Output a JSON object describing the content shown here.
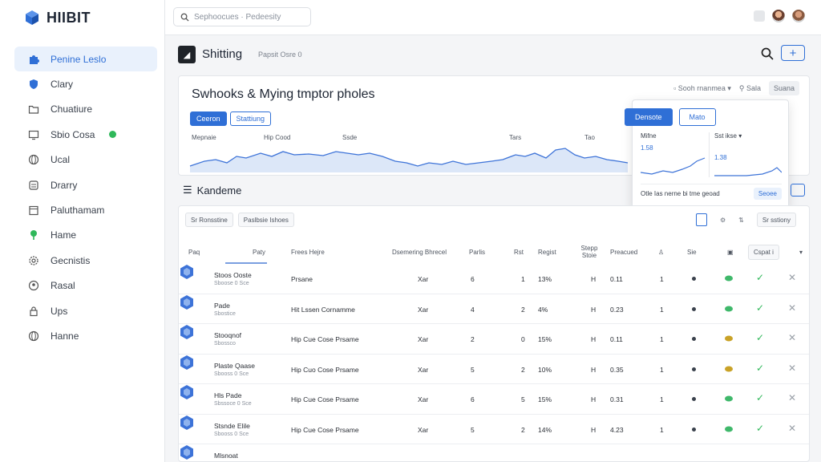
{
  "app": {
    "logo_text": "HIIBIT"
  },
  "search": {
    "placeholder": "Sephoocues · Pedeesity"
  },
  "sidebar": {
    "items": [
      {
        "label": "Penine Leslo",
        "icon": "puzzle-icon",
        "active": true
      },
      {
        "label": "Clary",
        "icon": "shield-icon"
      },
      {
        "label": "Chuatiure",
        "icon": "folder-icon"
      },
      {
        "label": "Sbio Cosa",
        "icon": "monitor-icon",
        "badge": "online"
      },
      {
        "label": "Ucal",
        "icon": "globe-icon"
      },
      {
        "label": "Drarry",
        "icon": "layers-icon"
      },
      {
        "label": "Paluthamam",
        "icon": "calendar-icon"
      },
      {
        "label": "Hame",
        "icon": "tree-icon"
      },
      {
        "label": "Gecnistis",
        "icon": "gear-icon"
      },
      {
        "label": "Rasal",
        "icon": "pin-icon"
      },
      {
        "label": "Ups",
        "icon": "lock-icon"
      },
      {
        "label": "Hanne",
        "icon": "globe-icon"
      }
    ]
  },
  "header": {
    "title": "Shitting",
    "subtitle": "Papsit Osre 0",
    "add_label": "+"
  },
  "card": {
    "title": "Swhooks & Mying tmptor pholes",
    "tool1": "Sooh rnanmea",
    "tool2": "Sala",
    "tool3": "Suana",
    "seg_on": "Ceeron",
    "seg_off": "Stattiung",
    "axis": [
      "Mepnaie",
      "Hip Cood",
      "Ssde",
      "Tars",
      "Tao"
    ]
  },
  "popover": {
    "btn_on": "Densote",
    "btn_off": "Mato",
    "left_label": "Mifne",
    "left_value": "1.58",
    "right_label": "Sst ikse",
    "right_value": "1.38",
    "footer_text": "Otle Ias nerne bi tme geoad",
    "footer_btn": "Seoee"
  },
  "section": {
    "title": "Kandeme"
  },
  "table": {
    "chips": [
      "Sr Ronsstine",
      "Paslbsie Ishoes"
    ],
    "toolbar_right": "Sr sstiony",
    "tab_label": "Paty",
    "headers": [
      "Paq",
      "Frees Hejre",
      "Dsemering Bhrecel",
      "Parlis",
      "Rst",
      "Regist",
      "Stepp Stoie",
      "Preacued",
      "Sie",
      "Cspat i"
    ],
    "rows": [
      {
        "name": "Stoos Ooste",
        "sub": "Sboose 0 Sce",
        "type": "Prsane",
        "rst": "Xar",
        "c1": "6",
        "c2": "1",
        "pct": "13%",
        "h": "H",
        "val": "0.11",
        "n": "1",
        "leaf": "green",
        "ok": "✓",
        "x": "✕"
      },
      {
        "name": "Pade",
        "sub": "Sbostice",
        "type": "Hit Lssen Cornamme",
        "rst": "Xar",
        "c1": "4",
        "c2": "2",
        "pct": "4%",
        "h": "H",
        "val": "0.23",
        "n": "1",
        "leaf": "green",
        "ok": "✓",
        "x": "✕"
      },
      {
        "name": "Stooqnof",
        "sub": "Sbossco",
        "type": "Hip Cue Cose Prsame",
        "rst": "Xar",
        "c1": "2",
        "c2": "0",
        "pct": "15%",
        "h": "H",
        "val": "0.11",
        "n": "1",
        "leaf": "gold",
        "ok": "✓",
        "x": "✕"
      },
      {
        "name": "Plaste Qaase",
        "sub": "Sbooss 0 Sce",
        "type": "Hip Cuo Cose Prsame",
        "rst": "Xar",
        "c1": "5",
        "c2": "2",
        "pct": "10%",
        "h": "H",
        "val": "0.35",
        "n": "1",
        "leaf": "gold",
        "ok": "✓",
        "x": "✕"
      },
      {
        "name": "Hls Pade",
        "sub": "Sbssoce 0 Sce",
        "type": "Hip Cue Cose Prsame",
        "rst": "Xar",
        "c1": "6",
        "c2": "5",
        "pct": "15%",
        "h": "H",
        "val": "0.31",
        "n": "1",
        "leaf": "green",
        "ok": "✓",
        "x": "✕"
      },
      {
        "name": "Stsnde Elile",
        "sub": "Sbooss 0 Sce",
        "type": "Hip Cue Cose Prsame",
        "rst": "Xar",
        "c1": "5",
        "c2": "2",
        "pct": "14%",
        "h": "H",
        "val": "4.23",
        "n": "1",
        "leaf": "green",
        "ok": "✓",
        "x": "✕"
      },
      {
        "name": "Mlsnoat",
        "sub": "",
        "type": "",
        "rst": "",
        "c1": "",
        "c2": "",
        "pct": "",
        "h": "",
        "val": "",
        "n": "",
        "leaf": "",
        "ok": "",
        "x": ""
      }
    ]
  },
  "colors": {
    "accent": "#2f6fd6",
    "success": "#2fb85a",
    "spark": "#3d73d8"
  }
}
